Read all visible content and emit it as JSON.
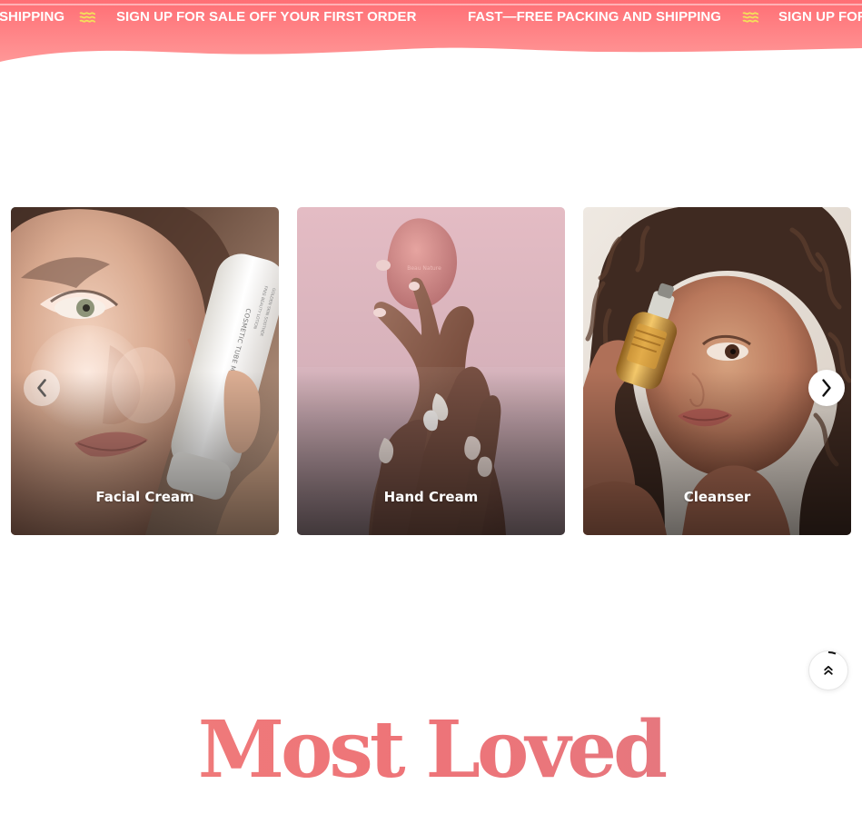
{
  "colors": {
    "promo_gradient_top": "#ff6e73",
    "promo_gradient_bottom": "#ff9292",
    "wave_icon": "#f7e55b",
    "heading": "#ef7377",
    "white": "#ffffff"
  },
  "promo": {
    "items": [
      {
        "text": "SHIPPING"
      },
      {
        "text": "SIGN UP FOR SALE OFF YOUR FIRST ORDER"
      },
      {
        "text": "FAST—FREE PACKING AND SHIPPING"
      },
      {
        "text": "SIGN UP FOR"
      }
    ],
    "icon": "wavy-lines-icon"
  },
  "carousel": {
    "prev_icon": "chevron-left-icon",
    "next_icon": "chevron-right-icon",
    "cards": [
      {
        "title": "Facial Cream",
        "image_icon": "facial-cream-photo"
      },
      {
        "title": "Hand Cream",
        "image_icon": "hand-cream-photo"
      },
      {
        "title": "Cleanser",
        "image_icon": "cleanser-photo"
      }
    ],
    "product_labels": {
      "tube_main": "COSMETIC TUBE MOCKUP",
      "tube_small_1": "GOLDEN SKIN SOOTHER",
      "tube_small_2": "FREE BEAUTY LOTION"
    }
  },
  "scroll_to_top": {
    "icon": "double-chevron-up-icon"
  },
  "section": {
    "title": "Most Loved"
  }
}
